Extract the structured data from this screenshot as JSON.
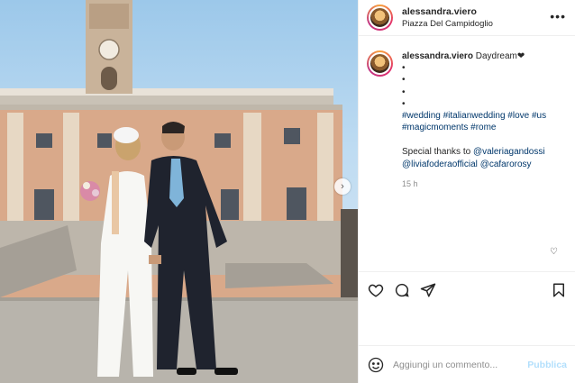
{
  "post": {
    "author": "alessandra.viero",
    "location": "Piazza Del Campidoglio",
    "more_icon": "more-horizontal-icon",
    "caption": {
      "username": "alessandra.viero",
      "text": "Daydream❤",
      "bullets": [
        "•",
        "•",
        "•",
        "•"
      ],
      "hashtags_line1": "#wedding #italianwedding #love #us",
      "hashtags_line2": "#magicmoments #rome",
      "thanks_prefix": "Special thanks to ",
      "mention1": "@valeriagandossi",
      "mention2": "@liviafoderaofficial",
      "mention3": "@cafarorosy"
    },
    "time_ago": "15 h",
    "comment_input_placeholder": "Aggiungi un commento...",
    "publish_label": "Pubblica"
  },
  "icons": {
    "like": "heart-icon",
    "comment": "comment-icon",
    "share": "send-icon",
    "save": "bookmark-icon",
    "emoji": "emoji-icon",
    "carousel_next": "chevron-right-icon"
  },
  "colors": {
    "link": "#00376b",
    "publish_disabled": "#b2dffc",
    "muted": "#8e8e8e",
    "text": "#262626"
  }
}
